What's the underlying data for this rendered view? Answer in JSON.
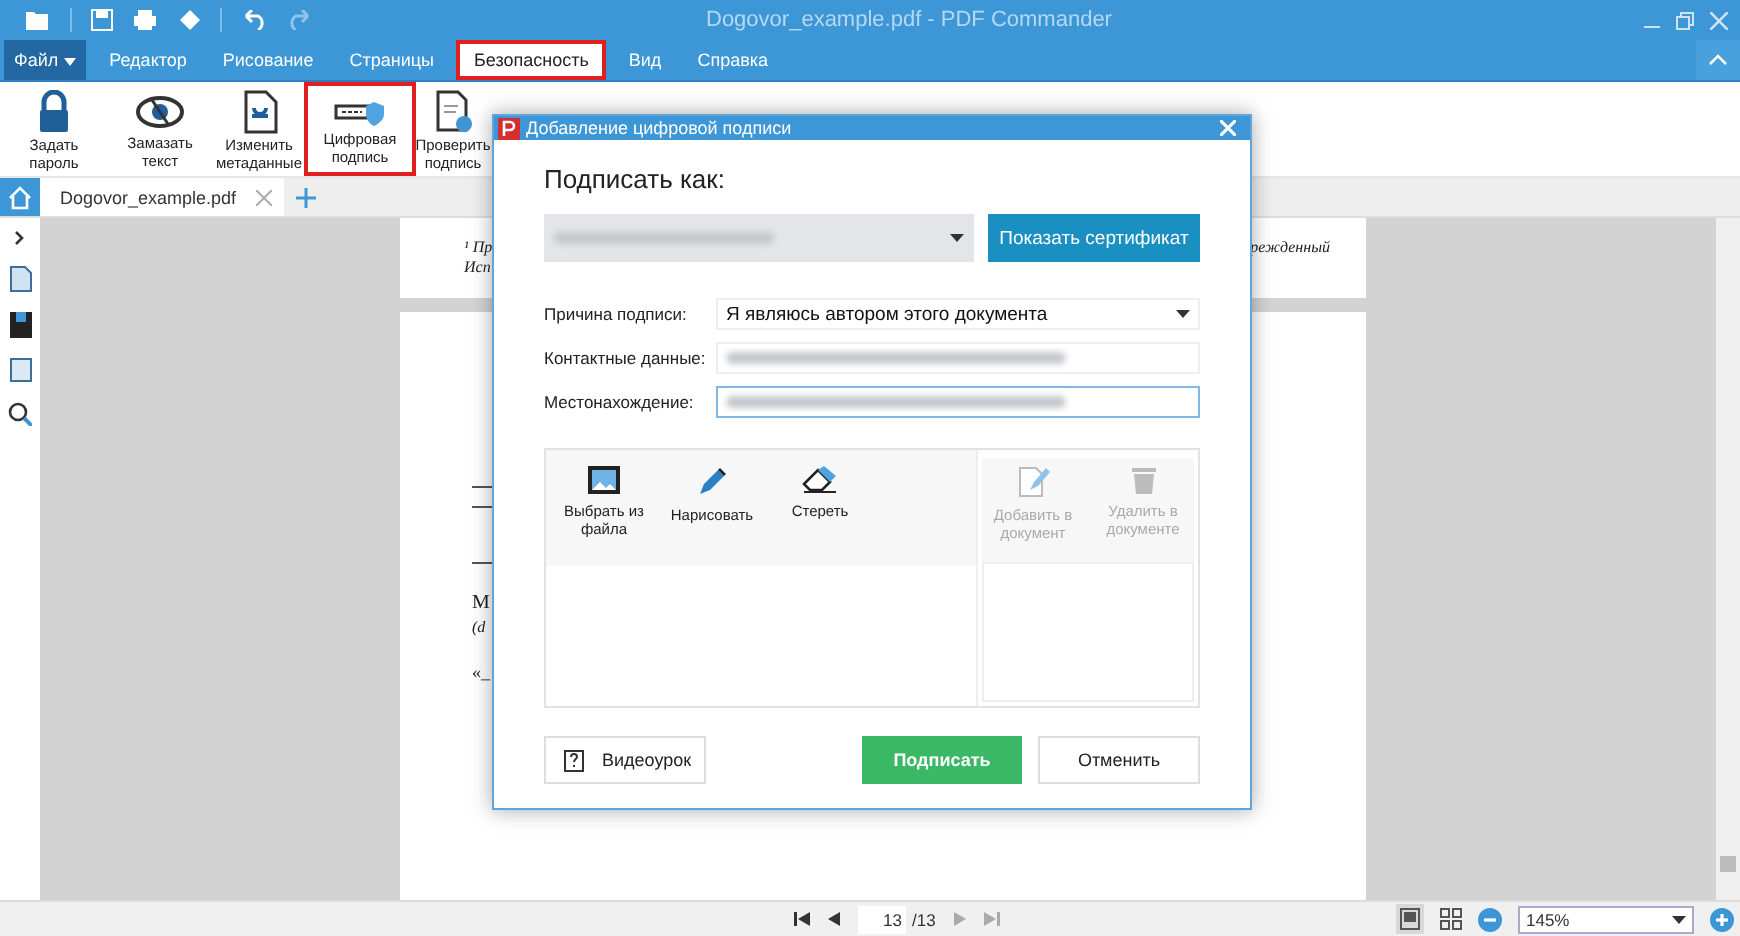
{
  "window": {
    "title": "Dogovor_example.pdf - PDF Commander"
  },
  "file_menu": {
    "label": "Файл"
  },
  "menu": [
    {
      "label": "Редактор",
      "kind": "tab",
      "selected": false
    },
    {
      "label": "Рисование",
      "kind": "tab",
      "selected": false
    },
    {
      "label": "Страницы",
      "kind": "tab",
      "selected": false
    },
    {
      "label": "Безопасность",
      "kind": "tab",
      "selected": true
    },
    {
      "label": "Вид",
      "kind": "tab",
      "selected": false
    },
    {
      "label": "Справка",
      "kind": "tab",
      "selected": false
    }
  ],
  "ribbon": [
    {
      "label": "Задать пароль",
      "kind": "lock",
      "highlighted": false
    },
    {
      "label": "Замазать текст",
      "kind": "eye",
      "highlighted": false
    },
    {
      "label": "Изменить метаданные",
      "kind": "meta",
      "highlighted": false
    },
    {
      "label": "Цифровая подпись",
      "kind": "sign",
      "highlighted": true
    },
    {
      "label": "Проверить подпись",
      "kind": "verify",
      "highlighted": false
    }
  ],
  "tabs": [
    {
      "label": "Dogovor_example.pdf",
      "selected": true
    }
  ],
  "document": {
    "lines": [
      "¹ Пр",
      "режденный",
      "Исп",
      "М",
      "(d",
      "«_"
    ]
  },
  "dialog": {
    "title": "Добавление цифровой подписи",
    "sign_as": "Подписать как:",
    "certificate_button": "Показать сертификат",
    "fields": [
      {
        "label": "Причина подписи:",
        "value": "Я являюсь автором этого документа",
        "kind": "dropdown",
        "focused": false
      },
      {
        "label": "Контактные данные:",
        "kind": "blurred",
        "focused": false
      },
      {
        "label": "Местонахождение:",
        "kind": "blurred",
        "focused": true
      }
    ],
    "tools": [
      {
        "label": "Выбрать из файла",
        "kind": "image",
        "disabled": false
      },
      {
        "label": "Нарисовать",
        "kind": "pen",
        "disabled": false
      },
      {
        "label": "Стереть",
        "kind": "eraser",
        "disabled": false
      }
    ],
    "side_tools": [
      {
        "label": "Добавить в документ",
        "kind": "add",
        "disabled": true
      },
      {
        "label": "Удалить в документе",
        "kind": "trash",
        "disabled": true
      }
    ],
    "video_button": "Видеоурок",
    "sign_button": "Подписать",
    "cancel_button": "Отменить"
  },
  "status": {
    "page": "13",
    "total": "/13",
    "zoom": "145%"
  }
}
